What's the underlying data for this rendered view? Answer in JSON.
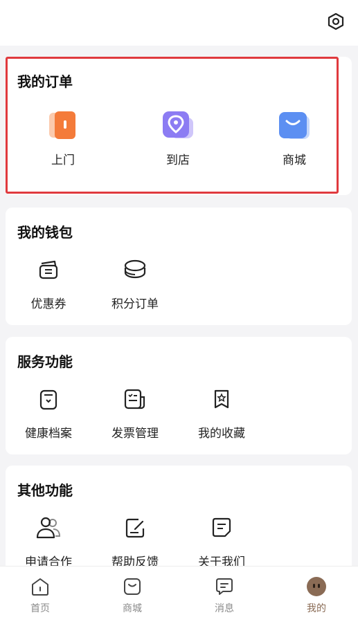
{
  "header": {
    "settings_icon": "settings-hexagon-icon"
  },
  "orders": {
    "title": "我的订单",
    "items": [
      {
        "label": "上门",
        "icon": "door-icon",
        "color": "#f47b3a"
      },
      {
        "label": "到店",
        "icon": "location-pin-icon",
        "color": "#8c7cf3"
      },
      {
        "label": "商城",
        "icon": "shopping-bag-icon",
        "color": "#5c8ff2"
      }
    ]
  },
  "wallet": {
    "title": "我的钱包",
    "items": [
      {
        "label": "优惠券",
        "icon": "coupon-icon"
      },
      {
        "label": "积分订单",
        "icon": "coins-icon"
      }
    ]
  },
  "services": {
    "title": "服务功能",
    "items": [
      {
        "label": "健康档案",
        "icon": "health-record-icon"
      },
      {
        "label": "发票管理",
        "icon": "invoice-icon"
      },
      {
        "label": "我的收藏",
        "icon": "bookmark-star-icon"
      }
    ]
  },
  "other": {
    "title": "其他功能",
    "items": [
      {
        "label": "申请合作",
        "icon": "users-icon"
      },
      {
        "label": "帮助反馈",
        "icon": "feedback-edit-icon"
      },
      {
        "label": "关于我们",
        "icon": "about-doc-icon"
      }
    ]
  },
  "nav": {
    "items": [
      {
        "label": "首页",
        "icon": "home-icon"
      },
      {
        "label": "商城",
        "icon": "shop-bag-icon"
      },
      {
        "label": "消息",
        "icon": "message-icon"
      },
      {
        "label": "我的",
        "icon": "avatar-icon",
        "active": true
      }
    ],
    "active_color": "#8a6b55",
    "inactive_color": "#8a8a8a"
  }
}
